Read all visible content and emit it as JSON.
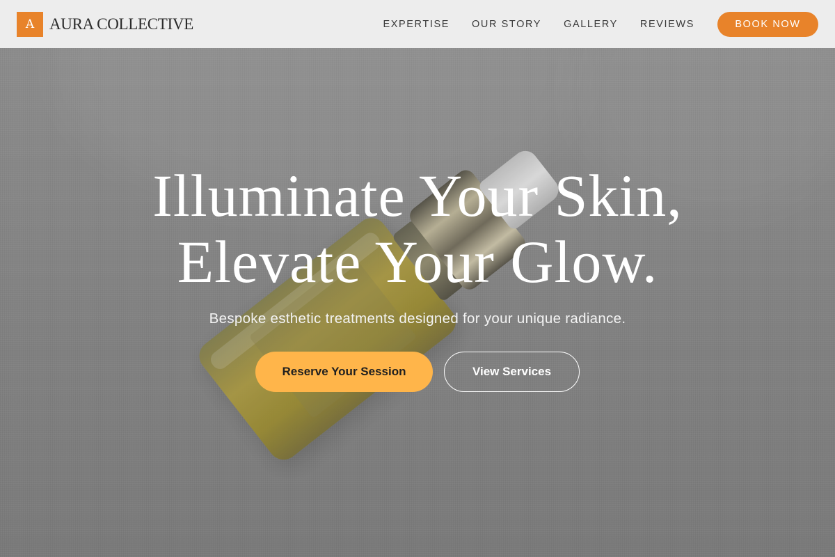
{
  "header": {
    "brand_mark": "A",
    "brand_name": "AURA COLLECTIVE",
    "nav": [
      "EXPERTISE",
      "OUR STORY",
      "GALLERY",
      "REVIEWS"
    ],
    "book_label": "BOOK NOW"
  },
  "hero": {
    "title_line1": "Illuminate Your Skin,",
    "title_line2": "Elevate Your Glow.",
    "subtitle": "Bespoke esthetic treatments designed for your unique radiance.",
    "primary_cta": "Reserve Your Session",
    "secondary_cta": "View Services"
  },
  "colors": {
    "accent": "#e8832a",
    "cta": "#ffb54a"
  }
}
